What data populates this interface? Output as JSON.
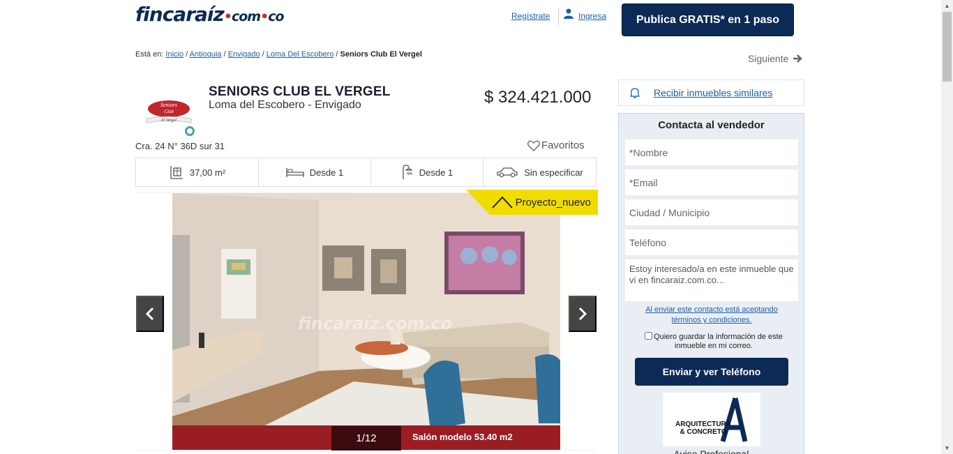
{
  "header": {
    "logo_main": "fincaraíz",
    "logo_sub": "com",
    "logo_tld": "co",
    "register_label": "Regístrate",
    "login_label": "Ingresa",
    "publish_label": "Publica GRATIS* en 1 paso"
  },
  "breadcrumb": {
    "prefix": "Está en:",
    "items": [
      "Inicio",
      "Antioquia",
      "Envigado",
      "Loma Del Escobero"
    ],
    "current": "Seniors Club El Vergel"
  },
  "next_label": "Siguiente",
  "listing": {
    "title": "SENIORS CLUB EL VERGEL",
    "subtitle": "Loma del Escobero - Envigado",
    "price": "$ 324.421.000",
    "address": "Cra. 24 N° 36D sur 31",
    "favorites_label": "Favoritos",
    "agency_logo_text": [
      "Seniors",
      "Club",
      "El Vergel"
    ],
    "features": {
      "area": "37,00 m²",
      "rooms": "Desde  1",
      "baths": "Desde  1",
      "parking": "Sin especificar"
    }
  },
  "gallery": {
    "badge": "Proyecto_nuevo",
    "counter": "1/12",
    "caption": "Salón modelo 53.40 m2",
    "watermark": "fincaraíz.com.co"
  },
  "sidebar": {
    "alert_label": "Recibir inmuebles similares",
    "contact_title": "Contacta al vendedor",
    "name_placeholder": "*Nombre",
    "email_placeholder": "*Email",
    "city_placeholder": "Ciudad / Municipio",
    "phone_placeholder": "Teléfono",
    "message_value": "Estoy interesado/a en este inmueble que vi en fincaraiz.com.co...",
    "terms_text": "Al enviar este contacto está aceptando términos y condiciones.",
    "save_info_label": "Quiero guardar la información de este inmueble en mi correo.",
    "send_label": "Enviar y ver Teléfono",
    "ad_logo_text": [
      "ARQUITECTURA",
      "& CONCRETO"
    ],
    "ad_label": "Aviso Profesional"
  }
}
